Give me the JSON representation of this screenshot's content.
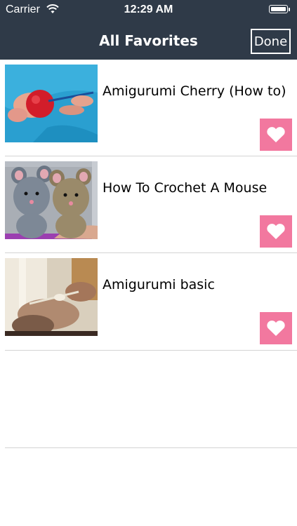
{
  "status_bar": {
    "carrier": "Carrier",
    "time": "12:29 AM"
  },
  "nav": {
    "title": "All Favorites",
    "done_label": "Done"
  },
  "favorites": [
    {
      "title": "Amigurumi Cherry (How to)",
      "thumbnail": "red crochet cherry on blue fabric"
    },
    {
      "title": "How To Crochet A Mouse",
      "thumbnail": "two crocheted mice"
    },
    {
      "title": "Amigurumi basic",
      "thumbnail": "hands holding crochet hook"
    }
  ],
  "colors": {
    "nav_background": "#2f3a48",
    "favorite_button": "#f2789f",
    "divider": "#d4d4d4"
  },
  "icons": {
    "favorite": "heart-icon",
    "wifi": "wifi-icon",
    "battery": "battery-icon"
  }
}
